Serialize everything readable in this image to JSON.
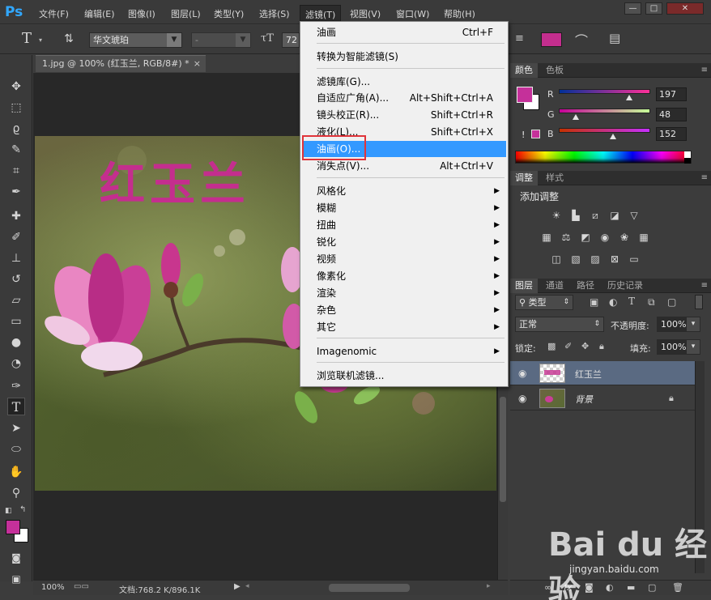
{
  "menubar": {
    "logo": "Ps",
    "items": [
      "文件(F)",
      "编辑(E)",
      "图像(I)",
      "图层(L)",
      "类型(Y)",
      "选择(S)",
      "滤镜(T)",
      "视图(V)",
      "窗口(W)",
      "帮助(H)"
    ],
    "active_index": 6,
    "win_min": "—",
    "win_max": "□",
    "win_close": "✕"
  },
  "options": {
    "font_family": "华文琥珀",
    "font_style": "-",
    "font_size": "72",
    "text_color": "#c42e8e"
  },
  "document": {
    "tab_title": "1.jpg @ 100% (红玉兰, RGB/8#) *",
    "tab_close": "×",
    "overlay_text": "红玉兰"
  },
  "status": {
    "zoom": "100%",
    "doc_info": "文档:768.2 K/896.1K"
  },
  "filter_menu": {
    "items": [
      {
        "label": "油画",
        "shortcut": "Ctrl+F"
      },
      {
        "label": "转换为智能滤镜(S)",
        "shortcut": ""
      },
      {
        "label": "滤镜库(G)...",
        "shortcut": ""
      },
      {
        "label": "自适应广角(A)...",
        "shortcut": "Alt+Shift+Ctrl+A"
      },
      {
        "label": "镜头校正(R)...",
        "shortcut": "Shift+Ctrl+R"
      },
      {
        "label": "液化(L)...",
        "shortcut": "Shift+Ctrl+X"
      },
      {
        "label": "油画(O)...",
        "shortcut": "",
        "highlighted": true
      },
      {
        "label": "消失点(V)...",
        "shortcut": "Alt+Ctrl+V"
      },
      {
        "label": "风格化",
        "submenu": true
      },
      {
        "label": "模糊",
        "submenu": true
      },
      {
        "label": "扭曲",
        "submenu": true
      },
      {
        "label": "锐化",
        "submenu": true
      },
      {
        "label": "视频",
        "submenu": true
      },
      {
        "label": "像素化",
        "submenu": true
      },
      {
        "label": "渲染",
        "submenu": true
      },
      {
        "label": "杂色",
        "submenu": true
      },
      {
        "label": "其它",
        "submenu": true
      },
      {
        "label": "Imagenomic",
        "submenu": true
      },
      {
        "label": "浏览联机滤镜...",
        "shortcut": ""
      }
    ],
    "submenu_arrow": "▶"
  },
  "color_panel": {
    "tabs": [
      "颜色",
      "色板"
    ],
    "r_label": "R",
    "g_label": "G",
    "b_label": "B",
    "r": "197",
    "g": "48",
    "b": "152",
    "r_value": 197,
    "g_value": 48,
    "b_value": 152,
    "foreground": "#c5309a",
    "warning_icon": "!"
  },
  "adjust_panel": {
    "tabs": [
      "调整",
      "样式"
    ],
    "title": "添加调整"
  },
  "layers_panel": {
    "tabs": [
      "图层",
      "通道",
      "路径",
      "历史记录"
    ],
    "kind_filter": "类型",
    "blend_mode": "正常",
    "opacity_label": "不透明度:",
    "opacity": "100%",
    "lock_label": "锁定:",
    "fill_label": "填充:",
    "fill": "100%",
    "layers": [
      {
        "name": "红玉兰",
        "selected": true
      },
      {
        "name": "背景",
        "locked": true
      }
    ]
  },
  "watermark": {
    "logo": "Bai du 经验",
    "url": "jingyan.baidu.com"
  }
}
